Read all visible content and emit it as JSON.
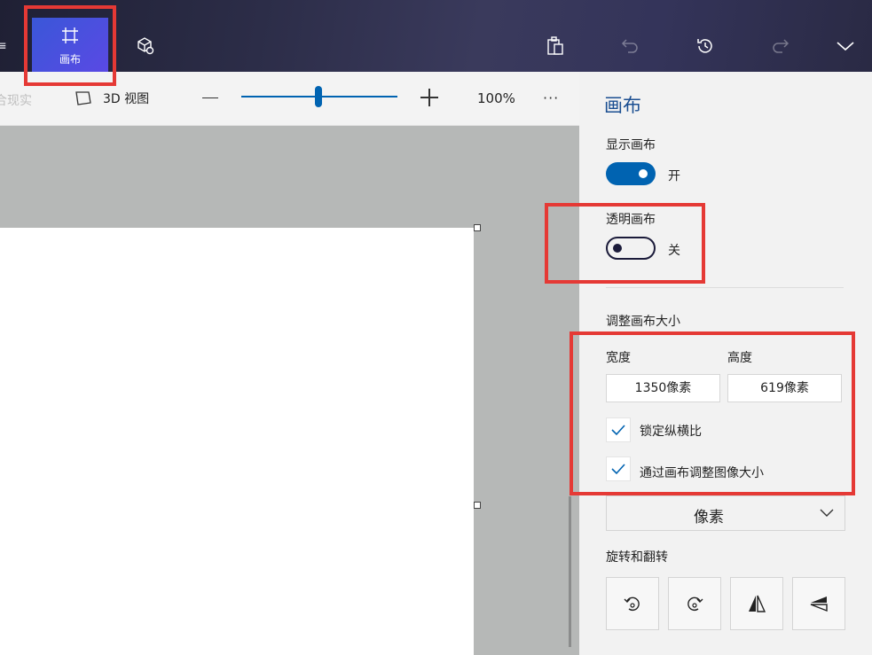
{
  "topbar": {
    "canvas_tab_label": "画布",
    "icons": [
      "menu-icon",
      "canvas-icon",
      "3d-library-icon",
      "paste-icon",
      "undo-icon",
      "history-icon",
      "redo-icon",
      "expand-icon"
    ]
  },
  "toolbar": {
    "mixed_reality_label": "合现实",
    "view3d_label": "3D 视图",
    "zoom_value": "100%",
    "more_label": "···",
    "zoom_level": 0.5
  },
  "panel": {
    "title": "画布",
    "show_canvas": {
      "label": "显示画布",
      "state_label": "开",
      "on": true
    },
    "transparent_canvas": {
      "label": "透明画布",
      "state_label": "关",
      "on": false
    },
    "resize_heading": "调整画布大小",
    "width_label": "宽度",
    "height_label": "高度",
    "width_value": "1350像素",
    "height_value": "619像素",
    "lock_aspect_label": "锁定纵横比",
    "lock_aspect_checked": true,
    "resize_image_label": "通过画布调整图像大小",
    "resize_image_checked": true,
    "unit_value": "像素",
    "rotate_heading": "旋转和翻转",
    "rotate_buttons": [
      "rotate-left-icon",
      "rotate-right-icon",
      "flip-horizontal-icon",
      "flip-vertical-icon"
    ]
  },
  "colors": {
    "accent": "#0063b1",
    "highlight": "#e53935",
    "panel_title": "#1a4e91"
  }
}
